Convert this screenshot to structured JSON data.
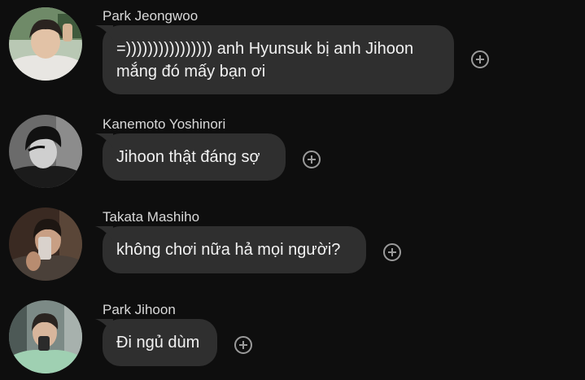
{
  "messages": [
    {
      "sender": "Park Jeongwoo",
      "text": "=)))))))))))))))) anh Hyunsuk bị anh Jihoon mắng đó mấy bạn ơi",
      "avatar": "profile-photo"
    },
    {
      "sender": "Kanemoto Yoshinori",
      "text": "Jihoon thật đáng sợ",
      "avatar": "profile-photo"
    },
    {
      "sender": "Takata Mashiho",
      "text": "không chơi nữa hả mọi người?",
      "avatar": "profile-photo"
    },
    {
      "sender": "Park Jihoon",
      "text": "Đi ngủ dùm",
      "avatar": "profile-photo"
    }
  ],
  "colors": {
    "background": "#0e0e0e",
    "bubble": "#2f2f2f",
    "sender_text": "#d9d9d9",
    "message_text": "#f2f2f2",
    "icon": "#9a9a9a"
  },
  "icons": {
    "react": "add-reaction-icon"
  }
}
